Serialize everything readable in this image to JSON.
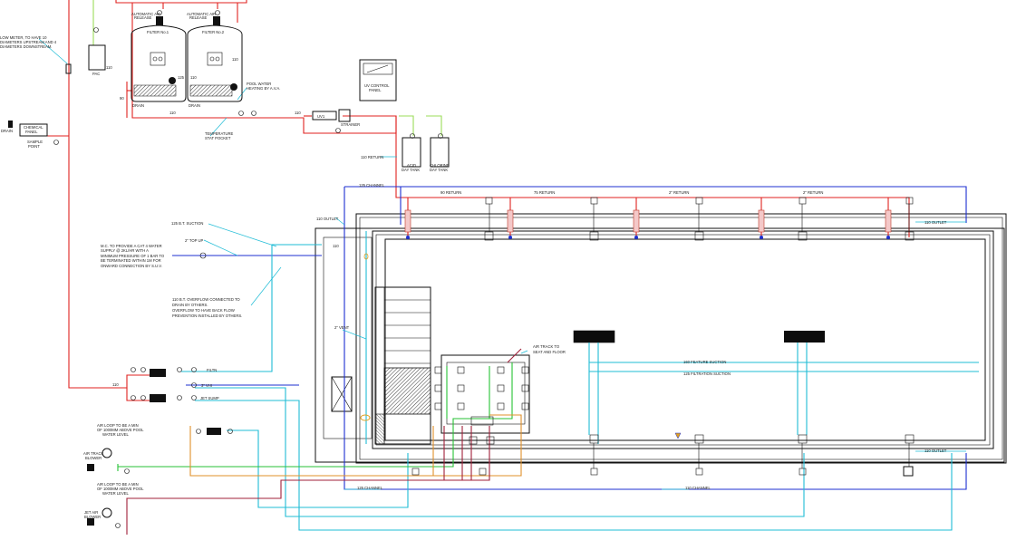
{
  "labels": {
    "water_meter_note": [
      "LOW METER, TO HAVE 10",
      "DIAMETERS UPSTREAM AND 4",
      "DIAMETERS DOWNSTREAM."
    ],
    "automatic_release_1": [
      "AUTOMATIC AIR",
      "RELEASE"
    ],
    "automatic_release_2": [
      "AUTOMATIC AIR",
      "RELEASE"
    ],
    "filter_1": "FILTER No.1",
    "filter_2": "FILTER No.2",
    "pac": "PAC",
    "drain_1": "DRAIN",
    "drain_2": "DRAIN",
    "drain_left": "DRAIN",
    "pool_water_heating": [
      "POOL WATER",
      "HEATING BY A.V.A."
    ],
    "chemical_panel": [
      "CHEMICAL",
      "PANEL"
    ],
    "sample_point": [
      "SAMPLE",
      "POINT"
    ],
    "temperature_pocket": [
      "TEMPERATURE",
      "STAT POCKET"
    ],
    "uv_control_panel": [
      "UV CONTROL",
      "PANEL"
    ],
    "strainer": "STRAINER",
    "acid_day_tank": [
      "ACID",
      "DAY TANK"
    ],
    "chlorine_day_tank": [
      "CHLORINE",
      "DAY TANK"
    ],
    "return_110": "110 RETURN",
    "channel_125_top": "125 CHANNEL",
    "return_90": "90 RETURN",
    "return_75": "75 RETURN",
    "return_2in_a": "2\" RETURN",
    "return_2in_b": "2\" RETURN",
    "outlet_110_left": "110 OUTLET",
    "outlet_110_right_top": "110 OUTLET",
    "bt_suction": "125 B.T. SUCTION",
    "top_up": "2\" TOP UP",
    "mc_note": [
      "M.C. TO PROVIDE A CAT 4 WATER",
      "SUPPLY @ 2KL/HR WITH A",
      "MINIMUM PRESSURE OF 1 BAR TO",
      "BE TERMINATED WITHIN 1M FOR",
      "ONWARD CONNECTION BY S.U.V."
    ],
    "overflow_note": [
      "110 B.T. OVERFLOW CONNECTED TO",
      "DRAIN BY OTHERS.",
      "OVERFLOW TO HAVE BACK FLOW",
      "PREVENTION INSTALLED BY OTHERS."
    ],
    "vent_2in": "2\" VENT",
    "air_track_note": [
      "AIR TRACK TO",
      "SEAT AND FLOOR"
    ],
    "feature_suction": "160 FEATURE SUCTION",
    "filtration_suction": "125 FILTRATION SUCTION",
    "outlet_110_right_bottom": "110 OUTLET",
    "channel_125_bottom": "125 CHANNEL",
    "channel_110_bottom": "110 CHANNEL",
    "air_loop_1": [
      "AIR LOOP TO BE A MIN",
      "OF 1000MM ABOVE POOL",
      "WATER LEVEL"
    ],
    "air_loop_2": [
      "AIR LOOP TO BE A MIN",
      "OF 1000MM ABOVE POOL",
      "WATER LEVEL"
    ],
    "air_track_blower": [
      "AIR TRACK",
      "BLOWER"
    ],
    "jet_air_blower": [
      "JET AIR",
      "BLOWER"
    ],
    "pump_legend_1": "FILTN",
    "pump_legend_2": "JET SUMP",
    "pump_legend_3": "3\" VHI",
    "ref_110_a": "110",
    "ref_110_b": "110",
    "ref_110_c": "110",
    "ref_110_d": "110",
    "ref_110_e": "110",
    "ref_110_f": "110",
    "ref_125": "125",
    "ref_90": "90",
    "ref_110_main": "110",
    "uv_tag": "UV1"
  },
  "colors": {
    "return_line": "#e0221f",
    "suction_line": "#1d2fd1",
    "feature_line": "#1fbcd6",
    "chemical_line": "#27c234",
    "chemical_light": "#9bdc5a",
    "air_line": "#e0902a",
    "air_dark": "#a0203a",
    "outline": "#111111"
  }
}
